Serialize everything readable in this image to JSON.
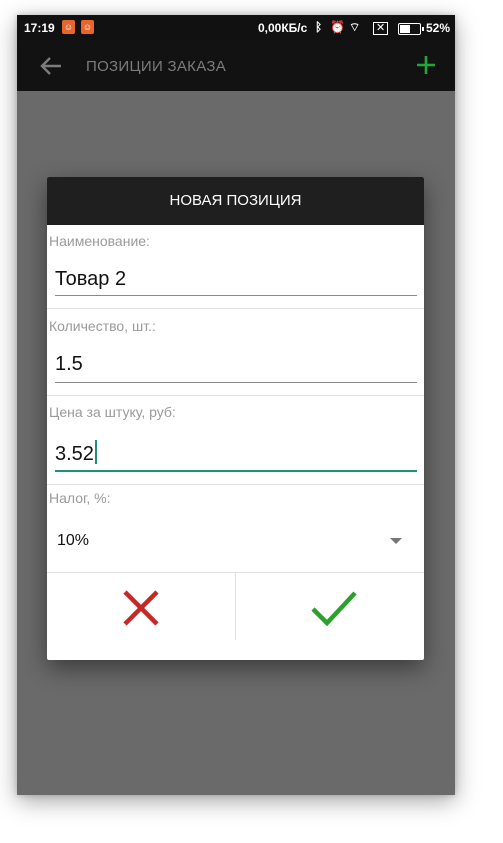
{
  "status_bar": {
    "time": "17:19",
    "network_speed": "0,00КБ/с",
    "battery_percent": "52%",
    "battery_level": 0.52
  },
  "app_bar": {
    "title": "ПОЗИЦИИ ЗАКАЗА",
    "back_icon": "arrow-left-icon",
    "add_icon": "plus-icon",
    "accent_color": "#22a83a"
  },
  "dialog": {
    "title": "НОВАЯ ПОЗИЦИЯ",
    "fields": [
      {
        "label": "Наименование:",
        "value": "Товар 2"
      },
      {
        "label": "Количество, шт.:",
        "value": "1.5"
      },
      {
        "label": "Цена за штуку, руб:",
        "value": "3.52"
      }
    ],
    "tax": {
      "label": "Налог, %:",
      "selected": "10%"
    },
    "cancel_color": "#c62828",
    "confirm_color": "#2aa22a"
  }
}
